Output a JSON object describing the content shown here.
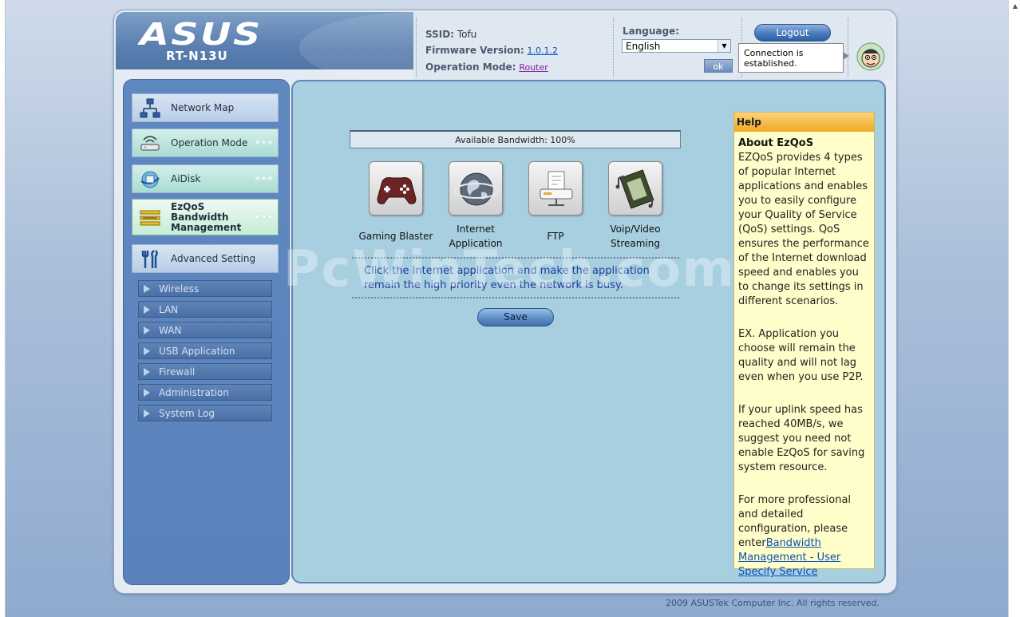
{
  "header": {
    "brand": "ASUS",
    "model": "RT-N13U",
    "ssid_label": "SSID:",
    "ssid_value": "Tofu",
    "firmware_label": "Firmware Version:",
    "firmware_value": "1.0.1.2",
    "opmode_label": "Operation Mode:",
    "opmode_value": "Router",
    "language_label": "Language:",
    "language_value": "English",
    "ok_label": "ok",
    "logout_label": "Logout",
    "connection_status": "Connection is established."
  },
  "sidebar": {
    "items": [
      {
        "label": "Network Map",
        "icon": "network-map-icon"
      },
      {
        "label": "Operation Mode",
        "icon": "router-icon",
        "stars": "★★★"
      },
      {
        "label": "AiDisk",
        "icon": "aidisk-icon",
        "stars": "★★★"
      },
      {
        "label": "EzQoS Bandwidth Management",
        "line1": "EzQoS",
        "line2": "Bandwidth",
        "line3": "Management",
        "icon": "bandwidth-icon",
        "stars": "★★★",
        "active": true
      },
      {
        "label": "Advanced Setting",
        "icon": "tools-icon"
      }
    ],
    "subitems": [
      "Wireless",
      "LAN",
      "WAN",
      "USB Application",
      "Firewall",
      "Administration",
      "System Log"
    ]
  },
  "main": {
    "bandwidth_text": "Available Bandwidth: 100%",
    "apps": [
      {
        "label": "Gaming Blaster",
        "icon": "gamepad-icon"
      },
      {
        "label": "Internet Application",
        "line1": "Internet",
        "line2": "Application",
        "icon": "globe-icon"
      },
      {
        "label": "FTP",
        "icon": "ftp-icon"
      },
      {
        "label": "Voip/Video Streaming",
        "line1": "Voip/Video",
        "line2": "Streaming",
        "icon": "film-icon"
      }
    ],
    "note": "Click the Internet application and make the application remain the high priority even the network is busy.",
    "save_label": "Save",
    "watermark": "PcWinTech.com"
  },
  "help": {
    "title": "Help",
    "heading": "About EzQoS",
    "p1": "EZQoS provides 4 types of popular Internet applications and enables you to easily configure your Quality of Service (QoS) settings. QoS ensures the performance of the Internet download speed and enables you to change its settings in different scenarios.",
    "p2": "EX. Application you choose will remain the quality and will not lag even when you use P2P.",
    "p3": "If your uplink speed has reached 40MB/s, we suggest you need not enable EzQoS for saving system resource.",
    "p4_prefix": "For more professional and detailed configuration, please enter",
    "p4_link": "Bandwidth Management - User Specify Service"
  },
  "footer": {
    "copyright": "2009 ASUSTek Computer Inc. All rights reserved."
  },
  "colors": {
    "sidebar_bg": "#5a82bc",
    "main_bg": "#a8cfe0",
    "help_bg": "#fffdc9",
    "help_title": "#f0a824",
    "link": "#0b52b8",
    "note_text": "#1d3a9c"
  }
}
